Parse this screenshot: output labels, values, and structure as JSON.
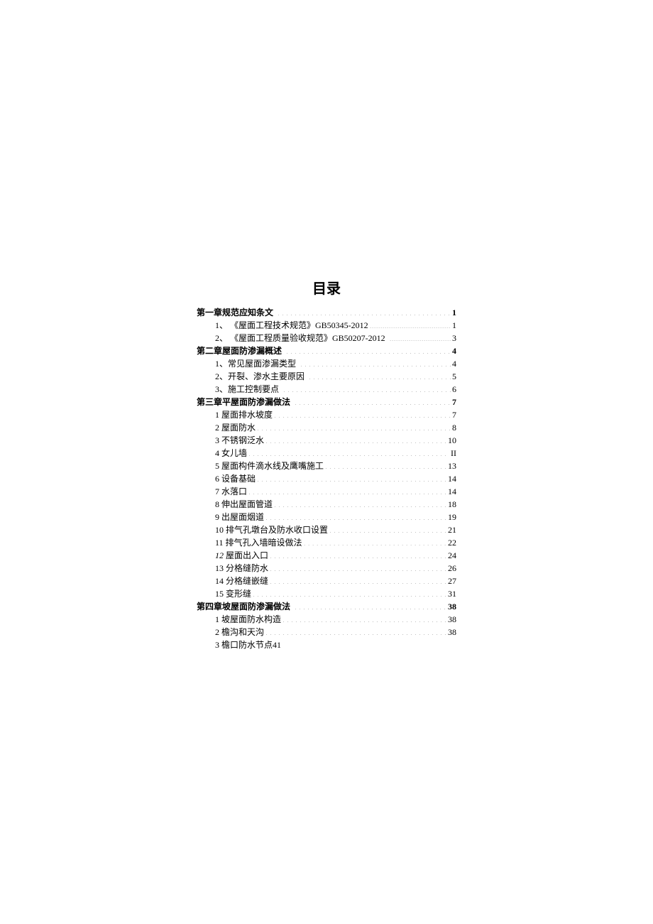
{
  "title": "目录",
  "entries": [
    {
      "label": "第一章规范应知条文",
      "page": "1",
      "level": 0,
      "bold": true,
      "leader": "dots",
      "labelSpace": true
    },
    {
      "label": "1、 《屋面工程技术规范》GB50345-2012",
      "page": "1",
      "level": 1,
      "bold": false,
      "leader": "dense",
      "labelSpace": false
    },
    {
      "label": "2、 《屋面工程质量验收规范》GB50207-2012",
      "page": "3",
      "level": 1,
      "bold": false,
      "leader": "dense",
      "labelSpace": true
    },
    {
      "label": "第二章屋面防渗漏概述",
      "page": "4",
      "level": 0,
      "bold": true,
      "leader": "dots",
      "labelSpace": true
    },
    {
      "label": "1、常见屋面渗漏类型",
      "page": "4",
      "level": 1,
      "bold": false,
      "leader": "dots",
      "labelSpace": true
    },
    {
      "label": "2、开裂、渗水主要原因",
      "page": "5",
      "level": 1,
      "bold": false,
      "leader": "dots",
      "labelSpace": true
    },
    {
      "label": "3、施工控制要点",
      "page": "6",
      "level": 1,
      "bold": false,
      "leader": "dots",
      "labelSpace": true
    },
    {
      "label": "第三章平屋面防渗漏做法",
      "page": "7",
      "level": 0,
      "bold": true,
      "leader": "dots",
      "labelSpace": true
    },
    {
      "label": "1 屋面排水坡度",
      "page": "7",
      "level": 1,
      "bold": false,
      "leader": "dots",
      "labelSpace": false
    },
    {
      "label": "2 屋面防水",
      "page": "8",
      "level": 1,
      "bold": false,
      "leader": "dots",
      "labelSpace": false
    },
    {
      "label": "3 不锈钢泛水",
      "page": "10",
      "level": 1,
      "bold": false,
      "leader": "dots",
      "labelSpace": false
    },
    {
      "label": "4 女儿墙",
      "page": "II",
      "level": 1,
      "bold": false,
      "leader": "dots",
      "labelSpace": false
    },
    {
      "label": "5 屋面构件滴水线及鹰嘴施工",
      "page": "13",
      "level": 1,
      "bold": false,
      "leader": "dots",
      "labelSpace": false
    },
    {
      "label": "6 设备基础",
      "page": "14",
      "level": 1,
      "bold": false,
      "leader": "dots",
      "labelSpace": false
    },
    {
      "label": "7 水落口",
      "page": "14",
      "level": 1,
      "bold": false,
      "leader": "dots",
      "labelSpace": false
    },
    {
      "label": "8 伸出屋面管道",
      "page": "18",
      "level": 1,
      "bold": false,
      "leader": "dots",
      "labelSpace": false
    },
    {
      "label": "9 出屋面烟道",
      "page": "19",
      "level": 1,
      "bold": false,
      "leader": "dots",
      "labelSpace": false
    },
    {
      "label": "10 排气孔墩台及防水收口设置",
      "page": "21",
      "level": 1,
      "bold": false,
      "leader": "dots",
      "labelSpace": false
    },
    {
      "label": "11 排气孔入墙暗设做法",
      "page": "22",
      "level": 1,
      "bold": false,
      "leader": "dots",
      "labelSpace": false
    },
    {
      "label": "12 屋面出入口",
      "page": "24",
      "level": 1,
      "bold": false,
      "leader": "dots",
      "labelSpace": false,
      "italicPrefix": "12"
    },
    {
      "label": "13 分格缝防水",
      "page": "26",
      "level": 1,
      "bold": false,
      "leader": "dots",
      "labelSpace": false
    },
    {
      "label": "14 分格缝嵌缝",
      "page": "27",
      "level": 1,
      "bold": false,
      "leader": "dots",
      "labelSpace": false
    },
    {
      "label": "15 变形缝",
      "page": "31",
      "level": 1,
      "bold": false,
      "leader": "dots",
      "labelSpace": false
    },
    {
      "label": "第四章坡屋面防渗漏做法",
      "page": "38",
      "level": 0,
      "bold": true,
      "leader": "dots",
      "labelSpace": true
    },
    {
      "label": "1 坡屋面防水构造",
      "page": "38",
      "level": 1,
      "bold": false,
      "leader": "dots",
      "labelSpace": false
    },
    {
      "label": "2 檐沟和天沟",
      "page": "38",
      "level": 1,
      "bold": false,
      "leader": "dots",
      "labelSpace": false
    },
    {
      "label": "3 檐口防水节点41",
      "page": "",
      "level": 1,
      "bold": false,
      "leader": "none",
      "labelSpace": false
    }
  ]
}
